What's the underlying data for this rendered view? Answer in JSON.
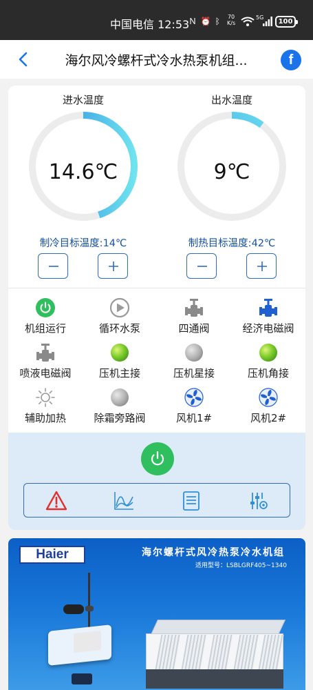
{
  "status_bar": {
    "carrier": "中国电信",
    "time": "12:53",
    "icons": [
      "nfc-icon",
      "alarm-icon",
      "bluetooth-icon"
    ],
    "speed_value": "70",
    "speed_unit": "K/s",
    "network": "5G",
    "battery": "100"
  },
  "header": {
    "title": "海尔风冷螺杆式冷水热泵机组..."
  },
  "gauges": [
    {
      "label": "进水温度",
      "value": "14.6℃",
      "fill_fraction": 0.45,
      "target_label": "制冷目标温度:14℃"
    },
    {
      "label": "出水温度",
      "value": "9℃",
      "fill_fraction": 0.1,
      "target_label": "制热目标温度:42℃"
    }
  ],
  "status_items": [
    {
      "label": "机组运行",
      "icon": "power-running-icon",
      "state": "on",
      "color": "#2fbf5f"
    },
    {
      "label": "循环水泵",
      "icon": "pump-icon",
      "state": "off",
      "color": "#9a9a9a"
    },
    {
      "label": "四通阀",
      "icon": "valve-icon",
      "state": "off",
      "color": "#8a8a8a"
    },
    {
      "label": "经济电磁阀",
      "icon": "valve-icon",
      "state": "on",
      "color": "#1f5fd1"
    },
    {
      "label": "喷液电磁阀",
      "icon": "valve-icon",
      "state": "off",
      "color": "#8a8a8a"
    },
    {
      "label": "压机主接",
      "icon": "indicator-light-icon",
      "state": "on",
      "color": "#6cc12c"
    },
    {
      "label": "压机星接",
      "icon": "indicator-light-icon",
      "state": "off",
      "color": "#a8a8a8"
    },
    {
      "label": "压机角接",
      "icon": "indicator-light-icon",
      "state": "on",
      "color": "#6cc12c"
    },
    {
      "label": "辅助加热",
      "icon": "heater-sun-icon",
      "state": "off",
      "color": "#9a9a9a"
    },
    {
      "label": "除霜旁路阀",
      "icon": "indicator-light-icon",
      "state": "off",
      "color": "#a8a8a8"
    },
    {
      "label": "风机1#",
      "icon": "fan-icon",
      "state": "on",
      "color": "#1f5fd1"
    },
    {
      "label": "风机2#",
      "icon": "fan-icon",
      "state": "on",
      "color": "#1f5fd1"
    }
  ],
  "controls": {
    "power_icon": "power-icon",
    "tools": [
      "alarm-warning-icon",
      "chart-trend-icon",
      "document-list-icon",
      "settings-sliders-icon"
    ]
  },
  "banner": {
    "logo": "Haier",
    "title": "海尔螺杆式风冷热泵冷水机组",
    "model": "适用型号：LSBLGRF405~1340"
  },
  "colors": {
    "accent_blue": "#2f6db8",
    "gauge_gradient_start": "#1f7fe0",
    "gauge_gradient_end": "#6fe3ef",
    "gauge_track": "#ececec",
    "power_green": "#2fbf5f",
    "alarm_red": "#e03030"
  }
}
